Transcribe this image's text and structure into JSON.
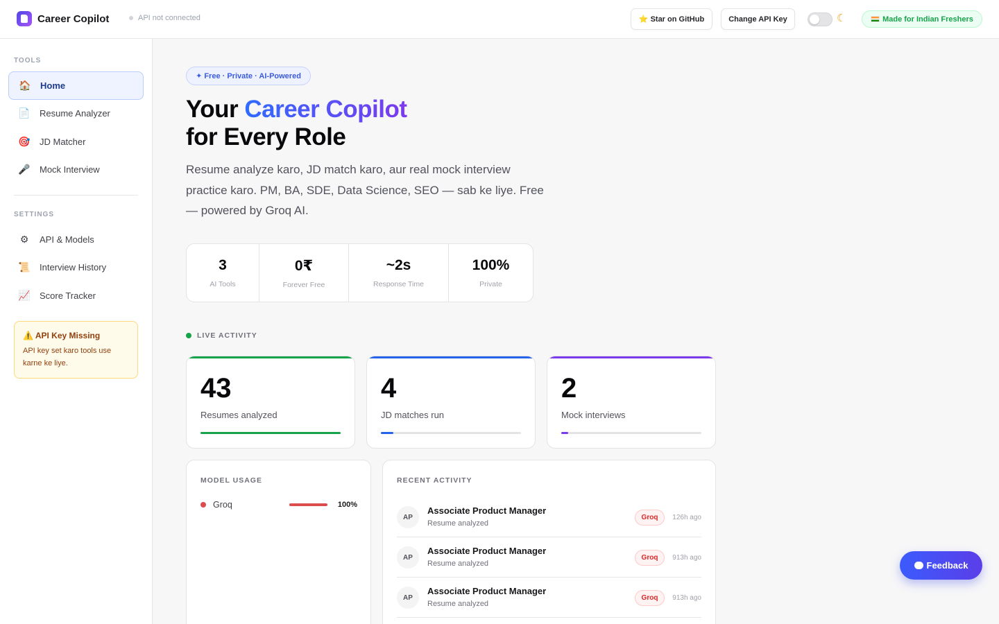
{
  "header": {
    "app_name": "Career Copilot",
    "api_status": "API not connected",
    "github_label": "⭐ Star on GitHub",
    "change_api_label": "Change API Key",
    "made_label": "Made for Indian Freshers"
  },
  "sidebar": {
    "tools_label": "TOOLS",
    "settings_label": "SETTINGS",
    "tools": [
      {
        "icon": "🏠",
        "label": "Home"
      },
      {
        "icon": "📄",
        "label": "Resume Analyzer"
      },
      {
        "icon": "🎯",
        "label": "JD Matcher"
      },
      {
        "icon": "🎤",
        "label": "Mock Interview"
      }
    ],
    "settings": [
      {
        "icon": "⚙",
        "label": "API & Models"
      },
      {
        "icon": "📜",
        "label": "Interview History"
      },
      {
        "icon": "📈",
        "label": "Score Tracker"
      }
    ],
    "warning": {
      "title": "⚠️ API Key Missing",
      "text": "API key set karo tools use karne ke liye."
    }
  },
  "hero": {
    "chip": "✦ Free · Private · AI-Powered",
    "title_prefix": "Your ",
    "title_highlight": "Career Copilot",
    "title_line2": "for Every Role",
    "subtitle": "Resume analyze karo, JD match karo, aur real mock interview practice karo. PM, BA, SDE, Data Science, SEO — sab ke liye. Free — powered by Groq AI."
  },
  "stats": [
    {
      "value": "3",
      "label": "AI Tools"
    },
    {
      "value": "0₹",
      "label": "Forever Free"
    },
    {
      "value": "~2s",
      "label": "Response Time"
    },
    {
      "value": "100%",
      "label": "Private"
    }
  ],
  "live_activity": {
    "label": "LIVE ACTIVITY",
    "cards": [
      {
        "value": "43",
        "label": "Resumes analyzed",
        "color": "#16a34a",
        "progress": 1.0
      },
      {
        "value": "4",
        "label": "JD matches run",
        "color": "#2563eb",
        "progress": 0.09
      },
      {
        "value": "2",
        "label": "Mock interviews",
        "color": "#7c3aed",
        "progress": 0.05
      }
    ]
  },
  "model_usage": {
    "title": "MODEL USAGE",
    "items": [
      {
        "name": "Groq",
        "percent": "100%",
        "color": "#dc4c4c"
      }
    ]
  },
  "recent_activity": {
    "title": "RECENT ACTIVITY",
    "items": [
      {
        "initials": "AP",
        "title": "Associate Product Manager",
        "subtitle": "Resume analyzed",
        "badge": "Groq",
        "time": "126h ago"
      },
      {
        "initials": "AP",
        "title": "Associate Product Manager",
        "subtitle": "Resume analyzed",
        "badge": "Groq",
        "time": "913h ago"
      },
      {
        "initials": "AP",
        "title": "Associate Product Manager",
        "subtitle": "Resume analyzed",
        "badge": "Groq",
        "time": "913h ago"
      }
    ]
  },
  "feedback_label": "Feedback"
}
